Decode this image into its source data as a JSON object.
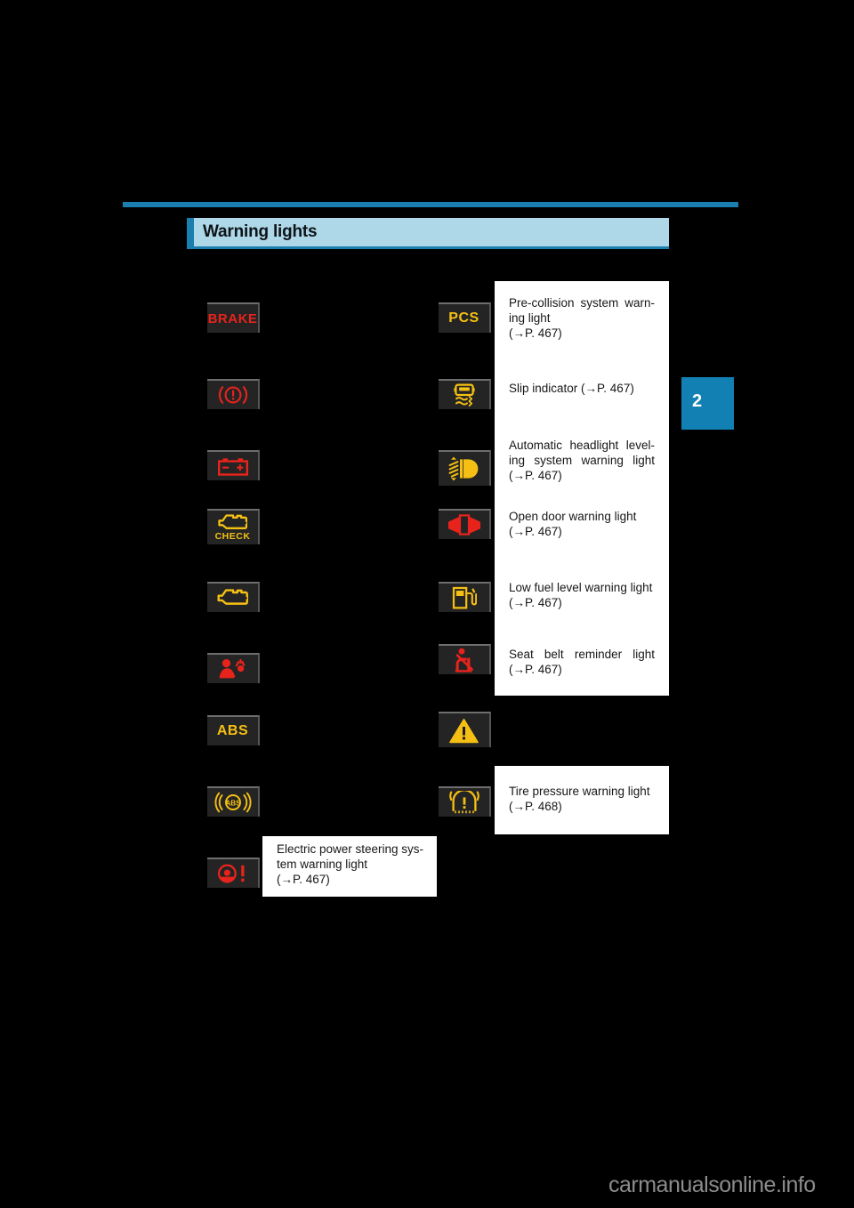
{
  "page": {
    "background_color": "#000000",
    "chapter_tab": "2",
    "watermark": "carmanualsonline.info"
  },
  "section": {
    "title": "Warning lights",
    "accent_color": "#1a7fae",
    "band_color": "#aed7e8"
  },
  "left_column": {
    "lights": [
      {
        "id": "brake-system-text",
        "icon_name": "brake-text-warning-icon",
        "label": "BRAKE",
        "color": "#e8231c",
        "kind": "text"
      },
      {
        "id": "brake-system-symbol",
        "icon_name": "brake-circle-exclamation-icon",
        "label": "",
        "color": "#e8231c",
        "kind": "glyph"
      },
      {
        "id": "charging-system",
        "icon_name": "battery-icon",
        "label": "",
        "color": "#e8231c",
        "kind": "glyph"
      },
      {
        "id": "check-engine-check",
        "icon_name": "engine-check-icon",
        "label": "CHECK",
        "color": "#f5c013",
        "kind": "glyph"
      },
      {
        "id": "malfunction-engine",
        "icon_name": "engine-icon",
        "label": "",
        "color": "#f5c013",
        "kind": "glyph"
      },
      {
        "id": "srs-airbag",
        "icon_name": "airbag-srs-icon",
        "label": "",
        "color": "#e8231c",
        "kind": "glyph"
      },
      {
        "id": "abs-text",
        "icon_name": "abs-text-icon",
        "label": "ABS",
        "color": "#f5c013",
        "kind": "text"
      },
      {
        "id": "brake-assist",
        "icon_name": "abs-parentheses-icon",
        "label": "ABS",
        "color": "#f5c013",
        "kind": "glyph"
      },
      {
        "id": "electric-power-steer",
        "icon_name": "steering-wheel-exclamation-icon",
        "label": "",
        "color": "#e8231c",
        "kind": "glyph"
      }
    ]
  },
  "right_column": {
    "lights": [
      {
        "id": "pre-collision",
        "icon_name": "pcs-text-icon",
        "label": "PCS",
        "color": "#f5c013",
        "kind": "text"
      },
      {
        "id": "slip-indicator",
        "icon_name": "slip-indicator-icon",
        "label": "",
        "color": "#f5c013",
        "kind": "glyph"
      },
      {
        "id": "headlight-leveling",
        "icon_name": "headlight-leveling-icon",
        "label": "",
        "color": "#f5c013",
        "kind": "glyph"
      },
      {
        "id": "open-door",
        "icon_name": "open-door-icon",
        "label": "",
        "color": "#e8231c",
        "kind": "glyph"
      },
      {
        "id": "low-fuel",
        "icon_name": "fuel-pump-icon",
        "label": "",
        "color": "#f5c013",
        "kind": "glyph"
      },
      {
        "id": "seat-belt-reminder",
        "icon_name": "seat-belt-icon",
        "label": "",
        "color": "#e8231c",
        "kind": "glyph"
      },
      {
        "id": "master-warning",
        "icon_name": "warning-triangle-icon",
        "label": "",
        "color": "#f5c013",
        "kind": "glyph"
      },
      {
        "id": "tire-pressure",
        "icon_name": "tire-pressure-icon",
        "label": "",
        "color": "#f5c013",
        "kind": "glyph"
      }
    ]
  },
  "descriptions": {
    "pcs": {
      "line1": "Pre-collision  system  warn-",
      "line2": "ing light",
      "line3": "(→P. 467)"
    },
    "slip": {
      "line1": "Slip indicator (→P. 467)"
    },
    "headlight": {
      "line1": "Automatic  headlight  level-",
      "line2": "ing   system   warning   light",
      "line3": "(→P. 467)"
    },
    "door": {
      "line1": "Open door warning light",
      "line2": "(→P. 467)"
    },
    "fuel": {
      "line1": "Low fuel level warning light",
      "line2": "(→P. 467)"
    },
    "seatbelt": {
      "line1": "Seat   belt   reminder   light",
      "line2": "(→P. 467)"
    },
    "tire": {
      "line1": "Tire pressure warning light",
      "line2": "(→P. 468)"
    },
    "eps": {
      "line1": "Electric power steering sys-",
      "line2": "tem warning light",
      "line3": "(→P. 467)"
    }
  }
}
